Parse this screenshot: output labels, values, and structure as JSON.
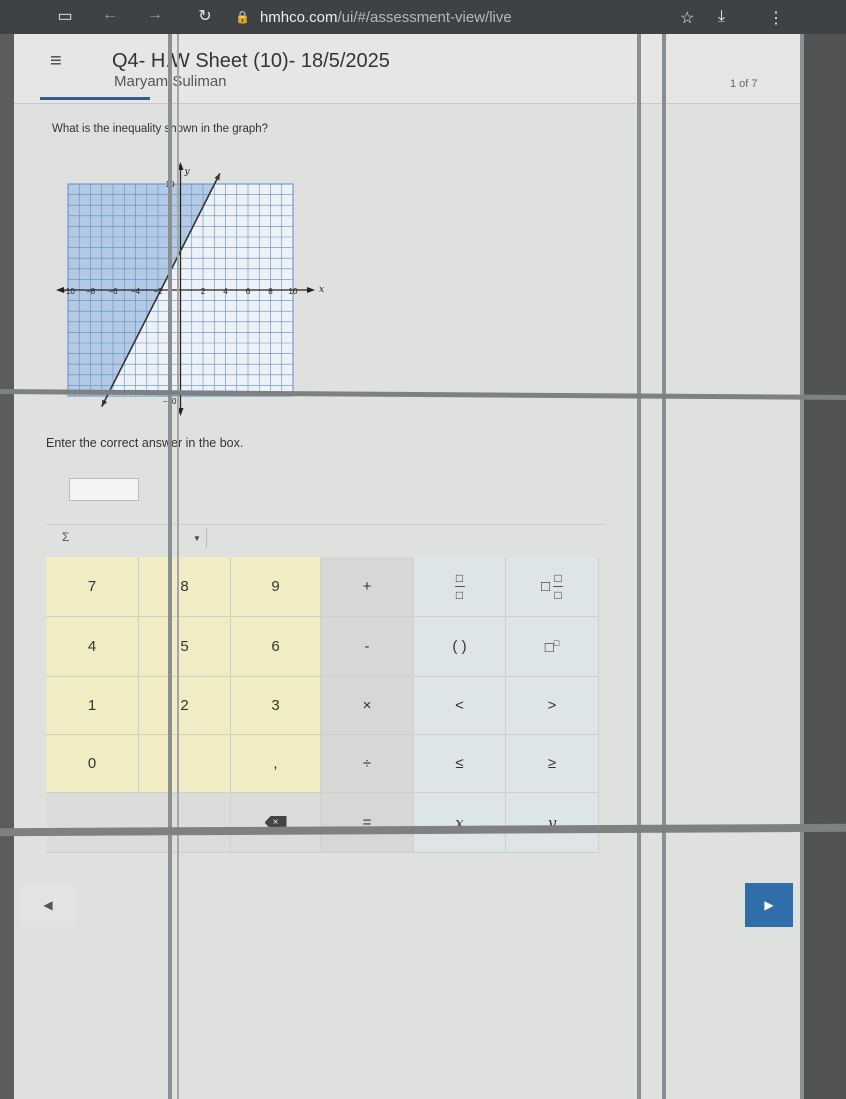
{
  "browser": {
    "url_host": "hmhco.com",
    "url_path": "/ui/#/assessment-view/live",
    "icons": [
      "tab-icon",
      "back-icon",
      "forward-icon",
      "reload-icon",
      "lock-icon",
      "star-icon",
      "download-icon",
      "menu-icon"
    ]
  },
  "header": {
    "title": "Q4- H.W Sheet (10)- 18/5/2025",
    "student": "Maryam Suliman",
    "page_count": "1 of 7"
  },
  "question": {
    "text": "What is the inequality shown in the graph?",
    "prompt": "Enter the correct answer in the box.",
    "answer_value": ""
  },
  "graph": {
    "x_axis_label": "x",
    "y_axis_label": "y",
    "x_ticks": [
      "−10",
      "−8",
      "−6",
      "−4",
      "−2",
      "0",
      "2",
      "4",
      "6",
      "8",
      "10"
    ],
    "y_ticks_visible": [
      "10",
      "−10"
    ],
    "x_range": [
      -10,
      10
    ],
    "y_range": [
      -10,
      10
    ],
    "grid": true,
    "boundary_line": {
      "style": "solid",
      "x1": -7,
      "y1": -11,
      "x2": 3.5,
      "y2": 11
    },
    "shaded_side": "left",
    "colors": {
      "grid": "#5a8fc5",
      "shade": "#a9c3e0",
      "line": "#333333"
    }
  },
  "toolbar": {
    "sigma": "Σ"
  },
  "keypad": {
    "numbers": [
      [
        "7",
        "8",
        "9"
      ],
      [
        "4",
        "5",
        "6"
      ],
      [
        "1",
        "2",
        "3"
      ],
      [
        "0",
        "",
        ","
      ]
    ],
    "ops": [
      "+",
      "-",
      "×",
      "÷",
      "="
    ],
    "sym_row1": [
      "( )"
    ],
    "sym_row3": [
      "<",
      ">"
    ],
    "sym_row4": [
      "≤",
      "≥"
    ],
    "sym_row5": [
      "x",
      "y"
    ],
    "colors": {
      "numbers": "#f1ecc3",
      "ops": "#d7d8d6",
      "symbols": "#dee5e8"
    }
  },
  "nav": {
    "prev_icon": "triangle-left-icon",
    "next_icon": "triangle-right-icon",
    "next_color": "#2f6ea8"
  }
}
